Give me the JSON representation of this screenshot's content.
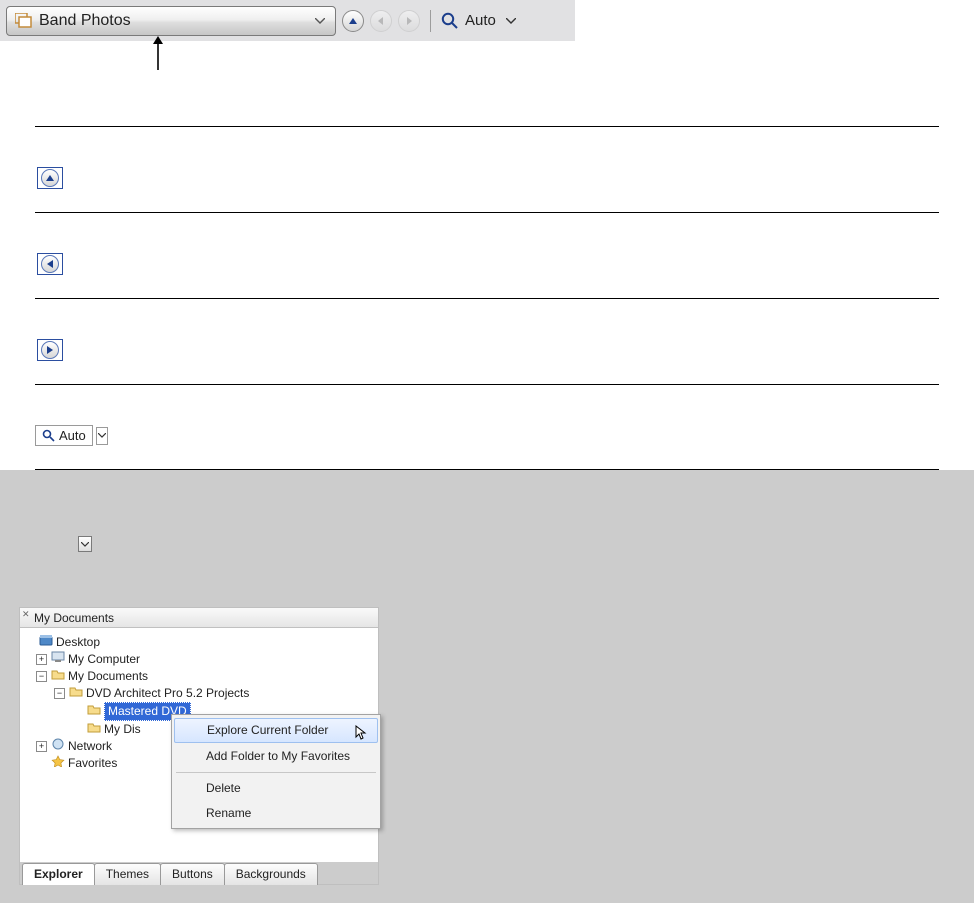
{
  "toolbar": {
    "dropdown_label": "Band Photos",
    "zoom_label": "Auto"
  },
  "cells": [
    {
      "kind": "up"
    },
    {
      "kind": "back"
    },
    {
      "kind": "forward"
    },
    {
      "kind": "auto",
      "label": "Auto"
    }
  ],
  "explorer": {
    "title": "My Documents",
    "tree": {
      "desktop": "Desktop",
      "my_computer": "My Computer",
      "my_documents": "My Documents",
      "dvd_project": "DVD Architect Pro 5.2 Projects",
      "mastered_dvd": "Mastered DVD",
      "my_dis": "My Dis",
      "network": "Network",
      "favorites": "Favorites"
    },
    "context_menu": {
      "explore": "Explore Current Folder",
      "add_fav": "Add Folder to My Favorites",
      "delete": "Delete",
      "rename": "Rename"
    },
    "tabs": [
      "Explorer",
      "Themes",
      "Buttons",
      "Backgrounds"
    ]
  }
}
